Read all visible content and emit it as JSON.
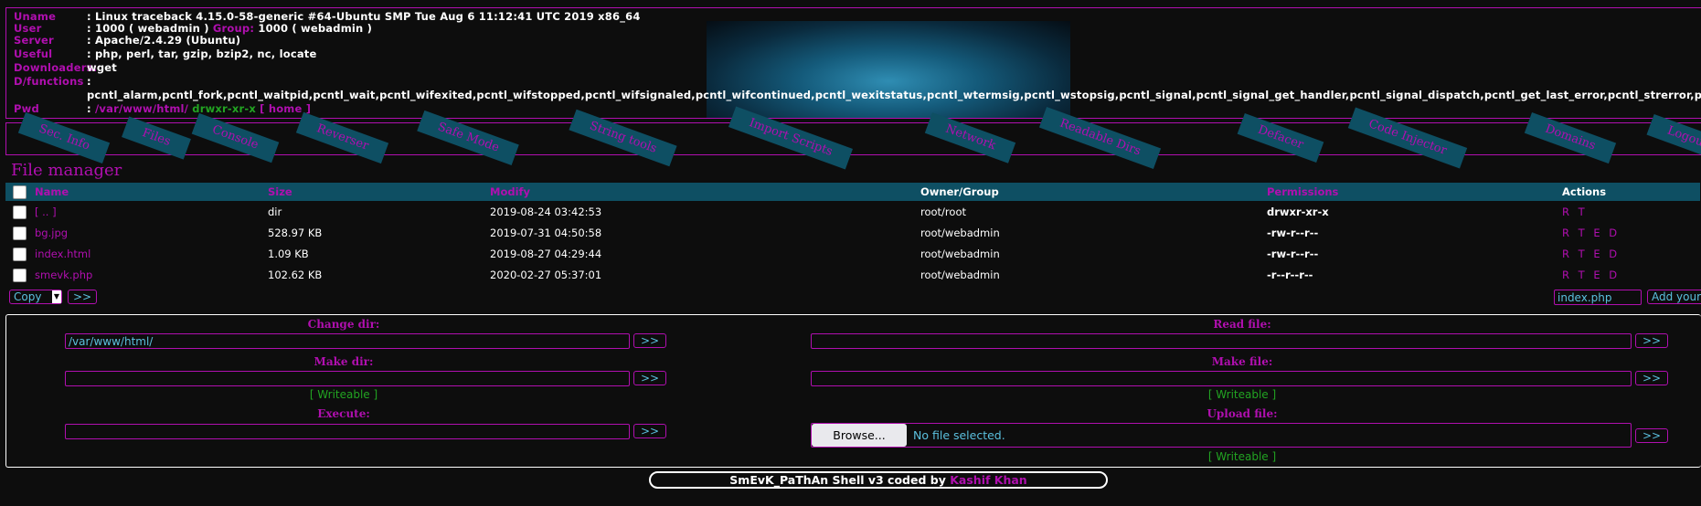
{
  "info": {
    "uname_key": "Uname",
    "uname": ": Linux traceback 4.15.0-58-generic #64-Ubuntu SMP Tue Aug 6 11:12:41 UTC 2019 x86_64",
    "user_key": "User",
    "user_val": ": 1000 ( webadmin )",
    "group_key": "Group:",
    "group_val": "1000 ( webadmin )",
    "server_key": "Server",
    "server": ": Apache/2.4.29 (Ubuntu)",
    "useful_key": "Useful",
    "useful": ": php, perl, tar, gzip, bzip2, nc, locate",
    "downloaders_key": "Downloaders:",
    "downloaders": "wget",
    "dfunctions_key": "D/functions",
    "dfunctions_colon": ":",
    "dfunctions": "pcntl_alarm,pcntl_fork,pcntl_waitpid,pcntl_wait,pcntl_wifexited,pcntl_wifstopped,pcntl_wifsignaled,pcntl_wifcontinued,pcntl_wexitstatus,pcntl_wtermsig,pcntl_wstopsig,pcntl_signal,pcntl_signal_get_handler,pcntl_signal_dispatch,pcntl_get_last_error,pcntl_strerror,pcntl_sigprocmask,pcntl_sigwaitinfo,pcntl_sigtimedwait,pcntl_exec",
    "pwd_key": "Pwd",
    "pwd_colon": ":",
    "pwd_path": "/var/www/html/",
    "pwd_perms": "drwxr-xr-x",
    "pwd_home": "[ home ]"
  },
  "nav": [
    "Sec. Info",
    "Files",
    "Console",
    "Reverser",
    "Safe Mode",
    "String tools",
    "Import Scripts",
    "Network",
    "Readable Dirs",
    "Defacer",
    "Code Injector",
    "Domains",
    "Logout"
  ],
  "file_manager": {
    "title": "File manager",
    "columns": [
      "Name",
      "Size",
      "Modify",
      "Owner/Group",
      "Permissions",
      "Actions"
    ],
    "rows": [
      {
        "name": "[ .. ]",
        "size": "dir",
        "modify": "2019-08-24 03:42:53",
        "owner": "root/root",
        "perms": "drwxr-xr-x",
        "actions": "R T"
      },
      {
        "name": "bg.jpg",
        "size": "528.97 KB",
        "modify": "2019-07-31 04:50:58",
        "owner": "root/webadmin",
        "perms": "-rw-r--r--",
        "actions": "R T E D"
      },
      {
        "name": "index.html",
        "size": "1.09 KB",
        "modify": "2019-08-27 04:29:44",
        "owner": "root/webadmin",
        "perms": "-rw-r--r--",
        "actions": "R T E D"
      },
      {
        "name": "smevk.php",
        "size": "102.62 KB",
        "modify": "2020-02-27 05:37:01",
        "owner": "root/webadmin",
        "perms": "-r--r--r--",
        "actions": "R T E D"
      }
    ],
    "action_select": "Copy",
    "go_label": ">>",
    "newfile_input": "index.php",
    "add_label": "Add your"
  },
  "tools": {
    "change_dir_label": "Change dir:",
    "change_dir_value": "/var/www/html/",
    "make_dir_label": "Make dir:",
    "execute_label": "Execute:",
    "read_file_label": "Read file:",
    "make_file_label": "Make file:",
    "upload_file_label": "Upload file:",
    "writeable": "[ Writeable ]",
    "browse_label": "Browse...",
    "no_file": "No file selected.",
    "go": ">>"
  },
  "footer": {
    "text": "SmEvK_PaThAn Shell v3 coded by ",
    "author": "Kashif Khan"
  },
  "colors": {
    "accent": "#b00faf",
    "header_bg": "#0e4f63",
    "link": "#5bc0de",
    "ok": "#22a422"
  }
}
